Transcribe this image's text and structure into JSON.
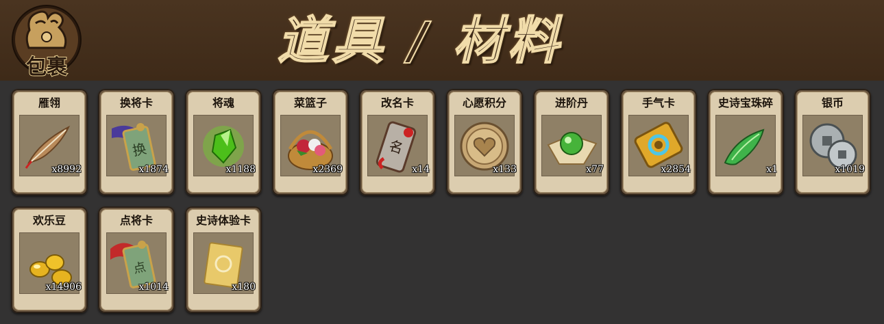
{
  "header": {
    "bag_label": "包裹",
    "title": "道具 / 材料"
  },
  "items": [
    {
      "name": "雁翎",
      "count": "x8992",
      "icon": "feather-icon"
    },
    {
      "name": "换将卡",
      "count": "x1874",
      "icon": "general-swap-card-icon"
    },
    {
      "name": "将魂",
      "count": "x1188",
      "icon": "green-crystal-icon"
    },
    {
      "name": "菜篮子",
      "count": "x2369",
      "icon": "flower-basket-icon"
    },
    {
      "name": "改名卡",
      "count": "x14",
      "icon": "rename-card-icon"
    },
    {
      "name": "心愿积分",
      "count": "x133",
      "icon": "heart-coin-icon"
    },
    {
      "name": "进阶丹",
      "count": "x77",
      "icon": "green-orb-icon"
    },
    {
      "name": "手气卡",
      "count": "x2854",
      "icon": "luck-card-icon"
    },
    {
      "name": "史诗宝珠碎",
      "count": "x1",
      "icon": "jade-shard-icon"
    },
    {
      "name": "银币",
      "count": "x1019",
      "icon": "silver-coin-icon"
    },
    {
      "name": "欢乐豆",
      "count": "x14906",
      "icon": "gold-beans-icon"
    },
    {
      "name": "点将卡",
      "count": "x1014",
      "icon": "general-pick-card-icon"
    },
    {
      "name": "史诗体验卡",
      "count": "x180",
      "icon": "epic-trial-card-icon"
    }
  ]
}
